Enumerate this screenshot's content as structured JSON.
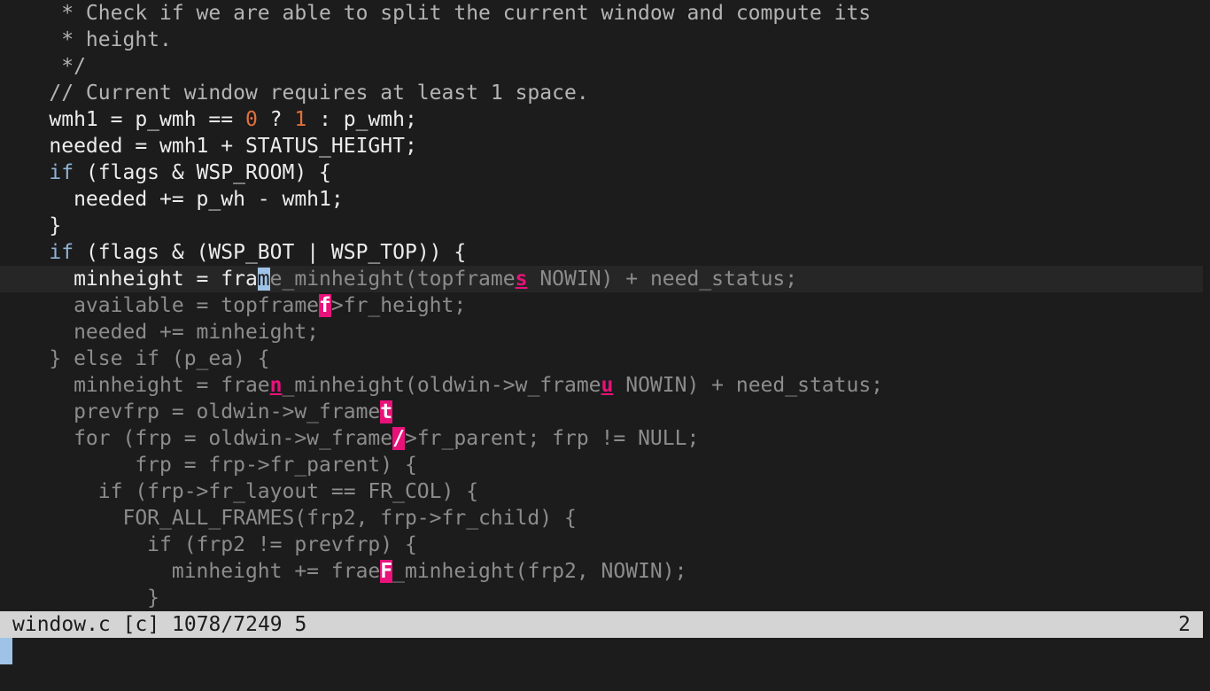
{
  "editor": {
    "lines": [
      {
        "segments": [
          {
            "t": "     * Check if we are able to split the current window and compute its",
            "c": "comment"
          }
        ]
      },
      {
        "segments": [
          {
            "t": "     * height.",
            "c": "comment"
          }
        ]
      },
      {
        "segments": [
          {
            "t": "     */",
            "c": "comment"
          }
        ]
      },
      {
        "segments": [
          {
            "t": "    // Current window requires at least 1 space.",
            "c": "comment"
          }
        ]
      },
      {
        "segments": [
          {
            "t": "    wmh1 = p_wmh == ",
            "c": "normal"
          },
          {
            "t": "0",
            "c": "number"
          },
          {
            "t": " ? ",
            "c": "normal"
          },
          {
            "t": "1",
            "c": "number"
          },
          {
            "t": " : p_wmh;",
            "c": "normal"
          }
        ]
      },
      {
        "segments": [
          {
            "t": "    needed = wmh1 + STATUS_HEIGHT;",
            "c": "normal"
          }
        ]
      },
      {
        "segments": [
          {
            "t": "    ",
            "c": "normal"
          },
          {
            "t": "if",
            "c": "keyword"
          },
          {
            "t": " (flags & WSP_ROOM) {",
            "c": "normal"
          }
        ]
      },
      {
        "segments": [
          {
            "t": "      needed += p_wh - wmh1;",
            "c": "normal"
          }
        ]
      },
      {
        "segments": [
          {
            "t": "    }",
            "c": "normal"
          }
        ]
      },
      {
        "segments": [
          {
            "t": "    ",
            "c": "normal"
          },
          {
            "t": "if",
            "c": "keyword"
          },
          {
            "t": " (flags & (WSP_BOT | WSP_TOP)) {",
            "c": "normal"
          }
        ]
      },
      {
        "cursorline": true,
        "segments": [
          {
            "t": "      minheight = fra",
            "c": "normal"
          },
          {
            "t": "m",
            "c": "cursor"
          },
          {
            "t": "e_minheight(topframe",
            "c": "dim"
          },
          {
            "t": "s",
            "c": "label2"
          },
          {
            "t": " NOWIN) + need_status;",
            "c": "dim"
          }
        ]
      },
      {
        "segments": [
          {
            "t": "      available = topframe",
            "c": "dim"
          },
          {
            "t": "f",
            "c": "label"
          },
          {
            "t": ">fr_height;",
            "c": "dim"
          }
        ]
      },
      {
        "segments": [
          {
            "t": "      needed += minheight;",
            "c": "dim"
          }
        ]
      },
      {
        "segments": [
          {
            "t": "    } else if (p_ea) {",
            "c": "dim"
          }
        ]
      },
      {
        "segments": [
          {
            "t": "      minheight = frae",
            "c": "dim"
          },
          {
            "t": "n",
            "c": "label2"
          },
          {
            "t": "_minheight(oldwin->w_frame",
            "c": "dim"
          },
          {
            "t": "u",
            "c": "label2"
          },
          {
            "t": " NOWIN) + need_status;",
            "c": "dim"
          }
        ]
      },
      {
        "segments": [
          {
            "t": "      prevfrp = oldwin->w_frame",
            "c": "dim"
          },
          {
            "t": "t",
            "c": "label"
          }
        ]
      },
      {
        "segments": [
          {
            "t": "      for (frp = oldwin->w_frame",
            "c": "dim"
          },
          {
            "t": "/",
            "c": "label"
          },
          {
            "t": ">fr_parent; frp != NULL;",
            "c": "dim"
          }
        ]
      },
      {
        "segments": [
          {
            "t": "           frp = frp->fr_parent) {",
            "c": "dim"
          }
        ]
      },
      {
        "segments": [
          {
            "t": "        if (frp->fr_layout == FR_COL) {",
            "c": "dim"
          }
        ]
      },
      {
        "segments": [
          {
            "t": "          FOR_ALL_FRAMES(frp2, frp->fr_child) {",
            "c": "dim"
          }
        ]
      },
      {
        "segments": [
          {
            "t": "            if (frp2 != prevfrp) {",
            "c": "dim"
          }
        ]
      },
      {
        "segments": [
          {
            "t": "              minheight += frae",
            "c": "dim"
          },
          {
            "t": "F",
            "c": "label"
          },
          {
            "t": "_minheight(frp2, NOWIN);",
            "c": "dim"
          }
        ]
      },
      {
        "segments": [
          {
            "t": "            }",
            "c": "dim"
          }
        ]
      }
    ]
  },
  "statusline": {
    "left": "window.c [c] 1078/7249 5",
    "right": "2"
  },
  "colors": {
    "background": "#1c1c1c",
    "statusline_bg": "#d4d4d4",
    "hint_label": "#e8127a",
    "cursor": "#9fc3e6"
  }
}
